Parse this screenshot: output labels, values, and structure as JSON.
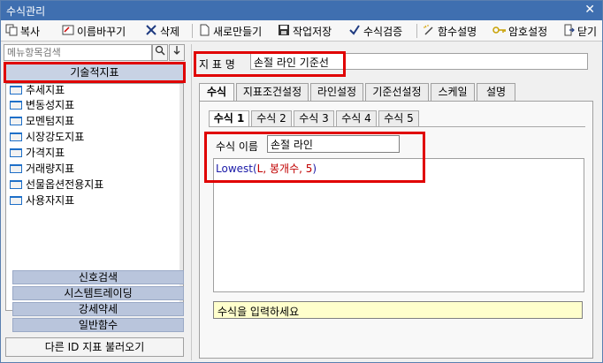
{
  "window": {
    "title": "수식관리",
    "close_glyph": "✕"
  },
  "toolbar": {
    "copy": "복사",
    "rename": "이름바꾸기",
    "delete": "삭제",
    "new": "새로만들기",
    "save": "작업저장",
    "verify": "수식검증",
    "func_help": "함수설명",
    "password": "암호설정",
    "close": "닫기"
  },
  "left": {
    "search_placeholder": "메뉴항목검색",
    "category_header": "기술적지표",
    "tree_items": [
      "추세지표",
      "변동성지표",
      "모멘텀지표",
      "시장강도지표",
      "가격지표",
      "거래량지표",
      "선물옵션전용지표",
      "사용자지표"
    ],
    "categories": [
      "신호검색",
      "시스템트레이딩",
      "강세약세",
      "일반함수"
    ],
    "load_button": "다른 ID 지표 불러오기"
  },
  "right": {
    "name_label": "지 표 명",
    "name_value": "손절 라인 기준선",
    "tabs": [
      "수식",
      "지표조건설정",
      "라인설정",
      "기준선설정",
      "스케일",
      "설명"
    ],
    "subtabs": [
      "수식 1",
      "수식 2",
      "수식 3",
      "수식 4",
      "수식 5"
    ],
    "formula_name_label": "수식 이름",
    "formula_name_value": "손절 라인",
    "formula": {
      "func": "Lowest",
      "open": "(",
      "args": "L, 봉개수, 5",
      "close": ")"
    },
    "hint": "수식을 입력하세요"
  },
  "colors": {
    "title_bar": "#3f6fb0",
    "highlight": "#e00000",
    "formula_func": "#1b1ba8",
    "formula_arg": "#c00000",
    "hint_bg": "#ffffcc",
    "category_bg": "#b9c5dc"
  }
}
